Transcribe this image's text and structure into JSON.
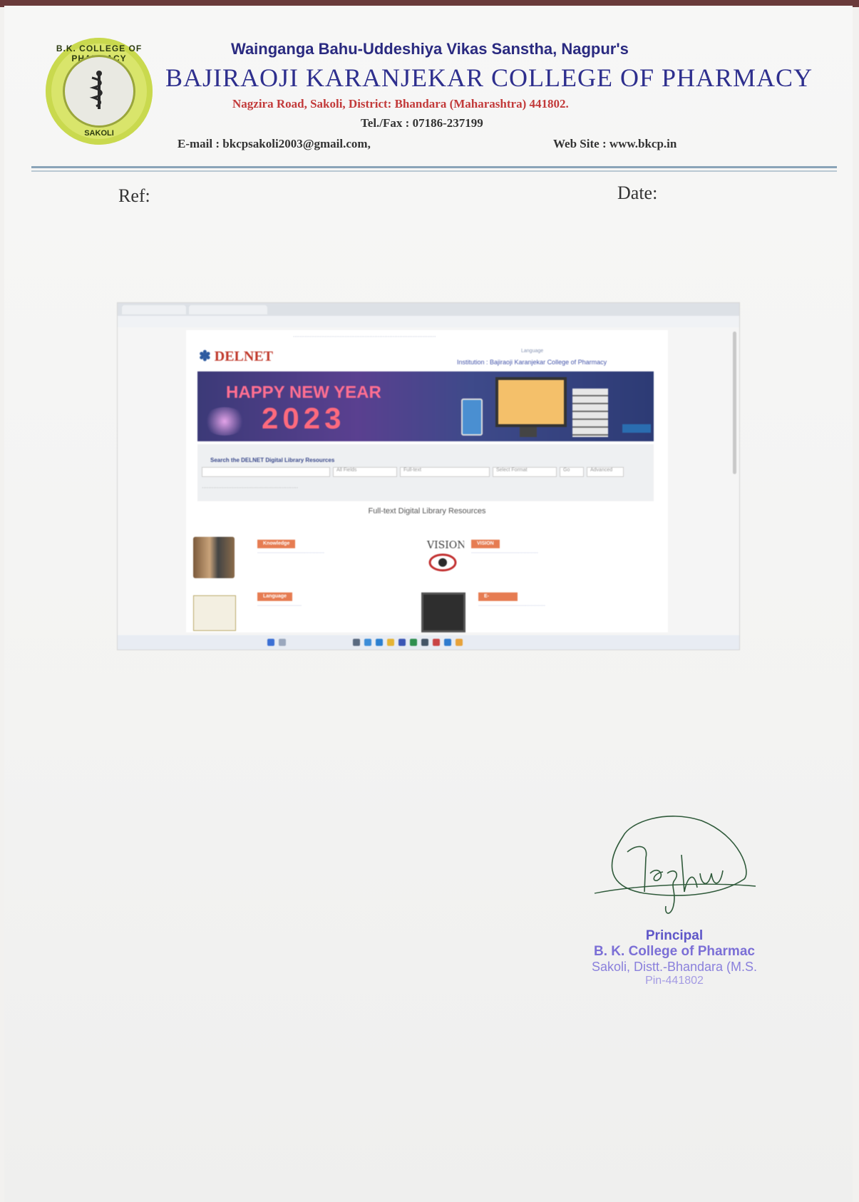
{
  "letterhead": {
    "society": "Wainganga Bahu-Uddeshiya Vikas Sanstha, Nagpur's",
    "college": "BAJIRAOJI KARANJEKAR COLLEGE OF PHARMACY",
    "address": "Nagzira Road, Sakoli, District: Bhandara (Maharashtra) 441802.",
    "telfax": "Tel./Fax : 07186-237199",
    "email": "E-mail : bkcpsakoli2003@gmail.com,",
    "website": "Web Site : www.bkcp.in",
    "logo_top_text": "B.K. COLLEGE OF PHARMACY",
    "logo_bottom_text": "SAKOLI",
    "logo_icon": "rod-of-asclepius-emblem"
  },
  "fields": {
    "ref_label": "Ref:",
    "date_label": "Date:"
  },
  "screenshot": {
    "site_logo": "DELNET",
    "banner_line1": "HAPPY NEW YEAR",
    "banner_line2": "2023",
    "search_title": "Search the DELNET Digital Library Resources",
    "search_field_all": "All Fields",
    "search_field_fulltext": "Full-text",
    "search_field_format": "Select Format",
    "search_go": "Go",
    "search_advanced": "Advanced",
    "fulltext_heading": "Full-text Digital Library Resources",
    "resources": [
      {
        "label": "Knowledge Center Portal",
        "icon": "books-thumbnail-icon"
      },
      {
        "label": "VISION Portal",
        "icon": "vision-eye-icon"
      },
      {
        "label": "Language Learning Portal",
        "icon": "welcome-thumbnail-icon"
      },
      {
        "label": "E-JOURNALS (Full Text)",
        "icon": "ereader-thumbnail-icon"
      }
    ],
    "institution_label": "Institution : Bajiraoji Karanjekar College of Pharmacy",
    "language_label": "Language"
  },
  "signature": {
    "signer_name": "Raghu"
  },
  "stamp": {
    "title": "Principal",
    "line1": "B. K. College of Pharmac",
    "line2": "Sakoli, Distt.-Bhandara (M.S.",
    "line3": "Pin-441802"
  },
  "colors": {
    "heading_blue": "#2e2f8e",
    "address_red": "#c23a3a",
    "stamp_violet": "#6a5fd0",
    "banner_pink": "#ff6f91"
  }
}
